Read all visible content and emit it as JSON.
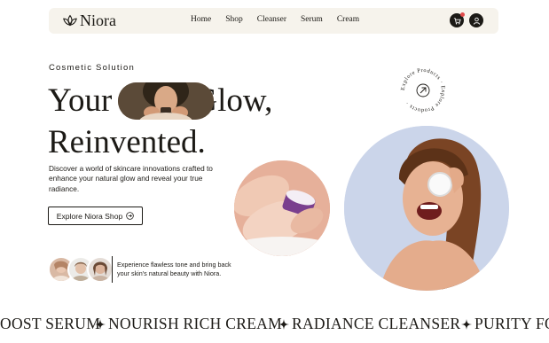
{
  "nav": {
    "logo_text": "Niora",
    "items": [
      "Home",
      "Shop",
      "Cleanser",
      "Serum",
      "Cream"
    ],
    "cart_icon": "cart-icon",
    "user_icon": "user-icon"
  },
  "hero": {
    "eyebrow": "Cosmetic Solution",
    "headline_part1": "Your",
    "headline_part2": "Glow,",
    "headline_line2": "Reinvented.",
    "description": "Discover a world of skincare innovations crafted to enhance your natural glow and reveal your true radiance.",
    "cta_label": "Explore Niora Shop"
  },
  "badge": {
    "text": "Explore Products · Explore Products ·"
  },
  "testimonial": {
    "text": "Experience flawless tone and bring back your skin's natural beauty with Niora."
  },
  "marquee": {
    "items": [
      "OOST SERUM",
      "NOURISH RICH CREAM",
      "RADIANCE CLEANSER",
      "PURITY FO"
    ]
  },
  "colors": {
    "nav_bg": "#f6f3ec",
    "ink": "#1c1a16",
    "cart_dot": "#e14b4b"
  }
}
